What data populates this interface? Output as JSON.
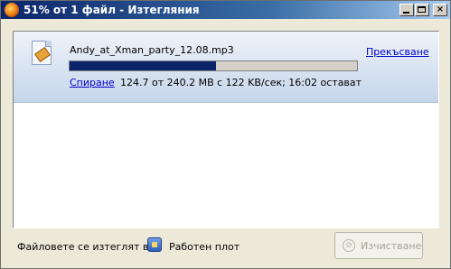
{
  "window": {
    "title": "51% от 1 файл - Изтегляния",
    "controls": {
      "minimize": "minimize-icon",
      "maximize": "maximize-icon",
      "close": "×"
    }
  },
  "download": {
    "file_name": "Andy_at_Xman_party_12.08.mp3",
    "progress_percent": 51,
    "cancel_label": "Прекъсване",
    "pause_label": "Спиране",
    "status": "124.7 от 240.2 MB с 122 KB/сек; 16:02 остават",
    "icon": "audio-file-icon"
  },
  "footer": {
    "location_label": "Файловете се изтеглят в:",
    "folder_name": "Работен плот",
    "folder_icon": "desktop-folder-icon",
    "clear_label": "Изчистване"
  },
  "colors": {
    "title_gradient_start": "#0a246a",
    "progress_fill": "#0a246a",
    "link": "#0000cc"
  }
}
